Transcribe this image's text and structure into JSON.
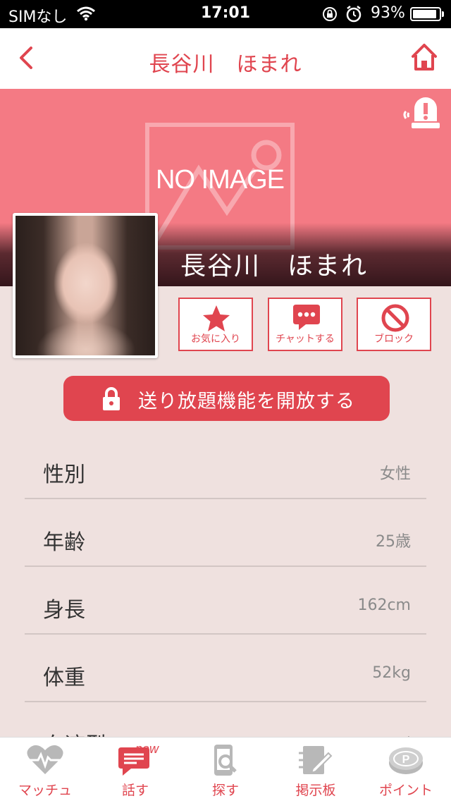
{
  "status_bar": {
    "carrier": "SIMなし",
    "time": "17:01",
    "battery": "93%",
    "battery_level": 0.93
  },
  "nav": {
    "title": "長谷川　ほまれ"
  },
  "header": {
    "placeholder_text": "NO IMAGE",
    "profile_name": "長谷川　ほまれ"
  },
  "actions": [
    {
      "label": "お気に入り",
      "icon": "star-icon"
    },
    {
      "label": "チャットする",
      "icon": "chat-bubble-icon"
    },
    {
      "label": "ブロック",
      "icon": "block-icon"
    }
  ],
  "unlock_button": {
    "label": "送り放題機能を開放する",
    "icon": "lock-icon"
  },
  "profile_rows": [
    {
      "key": "性別",
      "value": "女性"
    },
    {
      "key": "年齢",
      "value": "25歳"
    },
    {
      "key": "身長",
      "value": "162cm"
    },
    {
      "key": "体重",
      "value": "52kg"
    },
    {
      "key": "血液型",
      "value": "A型"
    }
  ],
  "tabs": [
    {
      "label": "マッチュ",
      "icon": "heartbeat-icon"
    },
    {
      "label": "話す",
      "icon": "chat-icon",
      "badge": "new"
    },
    {
      "label": "探す",
      "icon": "phone-search-icon"
    },
    {
      "label": "掲示板",
      "icon": "board-icon"
    },
    {
      "label": "ポイント",
      "icon": "point-coin-icon"
    }
  ],
  "colors": {
    "accent": "#e0454f",
    "header_bg": "#f47a84",
    "page_bg": "#efe1df"
  }
}
